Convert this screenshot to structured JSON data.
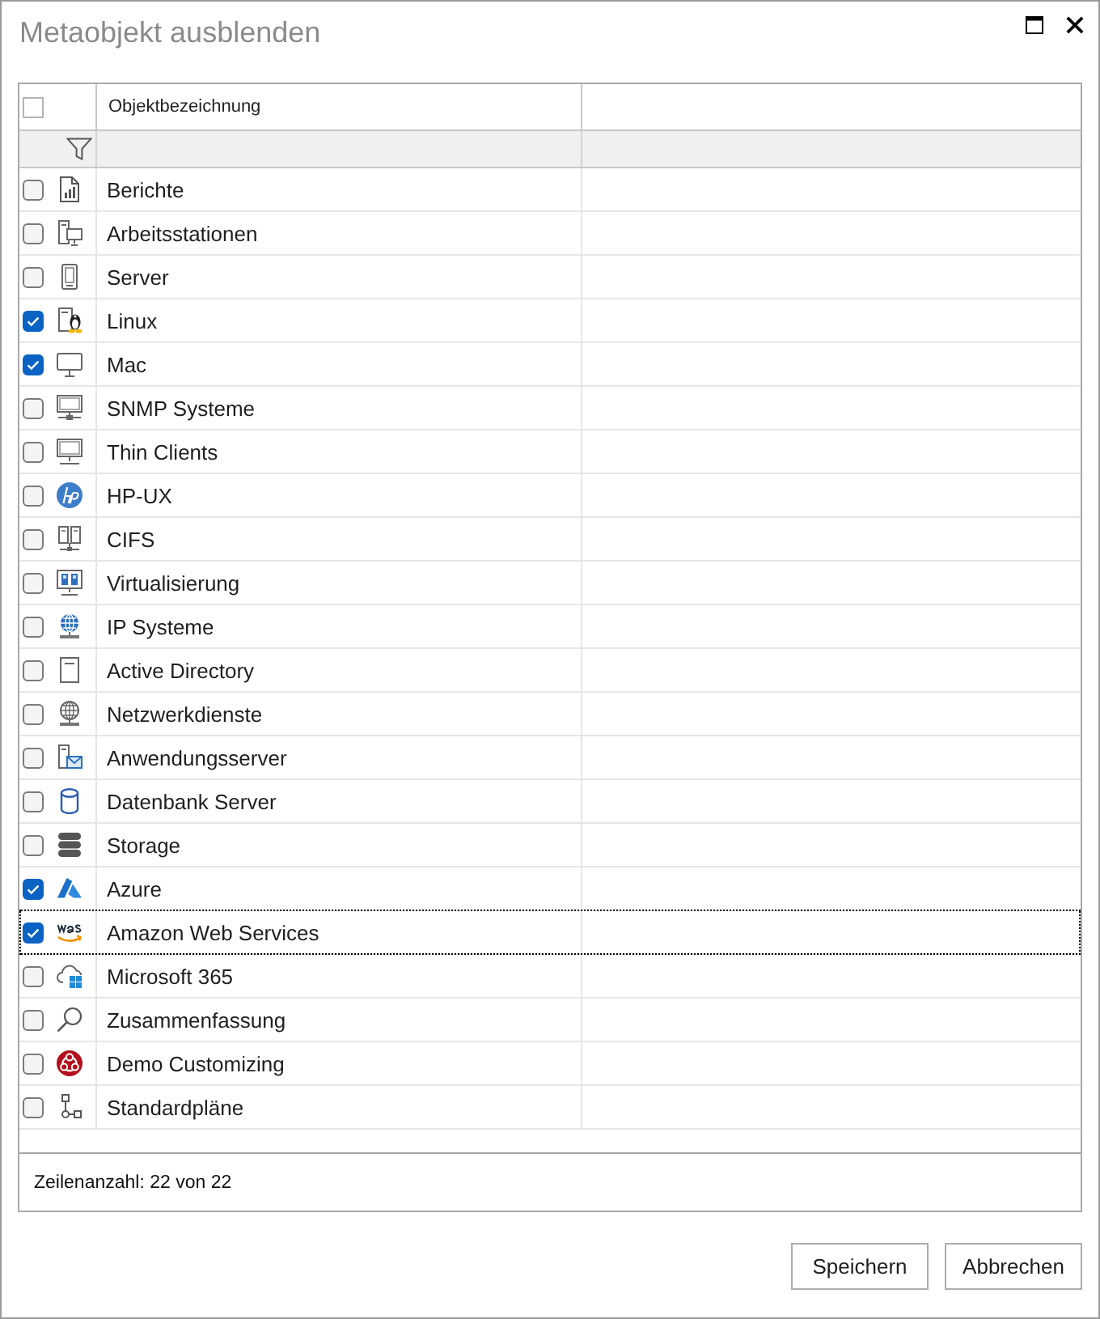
{
  "window": {
    "title": "Metaobjekt ausblenden"
  },
  "table": {
    "select_all": {
      "checked": false
    },
    "columns": [
      {
        "label": "Objektbezeichnung"
      }
    ],
    "rows": [
      {
        "kind": "report",
        "label": "Berichte",
        "checked": false,
        "focused": false
      },
      {
        "kind": "workstation",
        "label": "Arbeitsstationen",
        "checked": false,
        "focused": false
      },
      {
        "kind": "server",
        "label": "Server",
        "checked": false,
        "focused": false
      },
      {
        "kind": "linux",
        "label": "Linux",
        "checked": true,
        "focused": false
      },
      {
        "kind": "mac",
        "label": "Mac",
        "checked": true,
        "focused": false
      },
      {
        "kind": "snmp",
        "label": "SNMP Systeme",
        "checked": false,
        "focused": false
      },
      {
        "kind": "thinclient",
        "label": "Thin Clients",
        "checked": false,
        "focused": false
      },
      {
        "kind": "hpux",
        "label": "HP-UX",
        "checked": false,
        "focused": false
      },
      {
        "kind": "cifs",
        "label": "CIFS",
        "checked": false,
        "focused": false
      },
      {
        "kind": "virtualization",
        "label": "Virtualisierung",
        "checked": false,
        "focused": false
      },
      {
        "kind": "ipsystem",
        "label": "IP Systeme",
        "checked": false,
        "focused": false
      },
      {
        "kind": "directory",
        "label": "Active Directory",
        "checked": false,
        "focused": false
      },
      {
        "kind": "netservice",
        "label": "Netzwerkdienste",
        "checked": false,
        "focused": false
      },
      {
        "kind": "appserver",
        "label": "Anwendungsserver",
        "checked": false,
        "focused": false
      },
      {
        "kind": "database",
        "label": "Datenbank Server",
        "checked": false,
        "focused": false
      },
      {
        "kind": "storage",
        "label": "Storage",
        "checked": false,
        "focused": false
      },
      {
        "kind": "azure",
        "label": "Azure",
        "checked": true,
        "focused": false
      },
      {
        "kind": "aws",
        "label": "Amazon Web Services",
        "checked": true,
        "focused": true
      },
      {
        "kind": "m365",
        "label": "Microsoft 365",
        "checked": false,
        "focused": false
      },
      {
        "kind": "summary",
        "label": "Zusammenfassung",
        "checked": false,
        "focused": false
      },
      {
        "kind": "demo",
        "label": "Demo Customizing",
        "checked": false,
        "focused": false
      },
      {
        "kind": "plans",
        "label": "Standardpläne",
        "checked": false,
        "focused": false
      }
    ]
  },
  "status_bar": {
    "text": "Zeilenanzahl: 22 von 22"
  },
  "buttons": [
    {
      "label": "Speichern"
    },
    {
      "label": "Abbrechen"
    }
  ]
}
